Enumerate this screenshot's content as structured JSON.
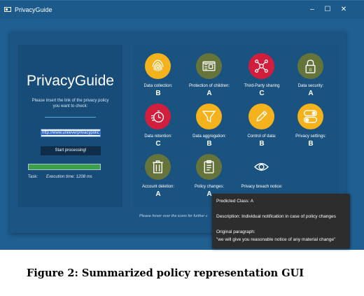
{
  "window": {
    "title": "PrivacyGuide",
    "controls": {
      "minimize": "–",
      "maximize": "☐",
      "close": "✕"
    }
  },
  "left": {
    "app_name": "PrivacyGuide",
    "prompt": "Please insert the link of the privacy policy you want to check:",
    "url_value": "http://www.unileverprivacypolic",
    "start_button": "Start processing!",
    "progress": 1.0,
    "task_label": "Task:",
    "execution_time": "Execution time: 1208 ms"
  },
  "categories": [
    {
      "label": "Data collection:",
      "grade": "B",
      "icon": "fingerprint-icon",
      "color": "#f4b21c"
    },
    {
      "label": "Protection of children:",
      "grade": "A",
      "icon": "id-card-icon",
      "color": "#65743a"
    },
    {
      "label": "Third-Party sharing",
      "grade": "C",
      "icon": "network-share-icon",
      "color": "#d01e3c"
    },
    {
      "label": "Data security:",
      "grade": "A",
      "icon": "padlock-icon",
      "color": "#65743a"
    },
    {
      "label": "Data retention:",
      "grade": "C",
      "icon": "stopwatch-icon",
      "color": "#d01e3c"
    },
    {
      "label": "Data aggregation:",
      "grade": "B",
      "icon": "funnel-icon",
      "color": "#f4b21c"
    },
    {
      "label": "Control of data:",
      "grade": "B",
      "icon": "pencil-icon",
      "color": "#f4b21c"
    },
    {
      "label": "Privacy settings:",
      "grade": "B",
      "icon": "toggle-icon",
      "color": "#f4b21c"
    },
    {
      "label": "Account deletion:",
      "grade": "A",
      "icon": "trash-icon",
      "color": "#65743a"
    },
    {
      "label": "Policy changes:",
      "grade": "A",
      "icon": "clipboard-icon",
      "color": "#65743a"
    },
    {
      "label": "Privacy breach notice:",
      "grade": "",
      "icon": "eye-icon",
      "color": ""
    }
  ],
  "footer_note": "Please hover over the icons for further c",
  "tooltip": {
    "predicted": "Predicted Class: A",
    "description": "Description: Individual notification in case of policy changes",
    "original_heading": "Original paragraph:",
    "original_text": "\"we will give you reasonable notice of any material change\""
  },
  "caption": "Figure 2: Summarized policy representation GUI"
}
